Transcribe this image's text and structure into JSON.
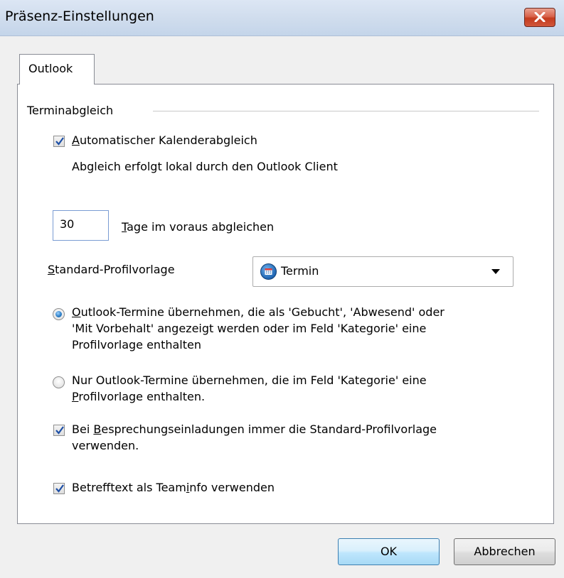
{
  "window": {
    "title": "Präsenz-Einstellungen"
  },
  "tabs": [
    {
      "label": "Outlook",
      "active": true
    }
  ],
  "group": {
    "label": "Terminabgleich"
  },
  "auto_sync": {
    "checked": true,
    "label_mnemonic": "A",
    "label_rest": "utomatischer Kalenderabgleich",
    "note": "Abgleich erfolgt lokal durch den Outlook Client"
  },
  "days_ahead": {
    "value": "30",
    "label_mnemonic": "T",
    "label_rest": "age im voraus abgleichen"
  },
  "profile_template": {
    "label_mnemonic": "S",
    "label_rest": "tandard-Profilvorlage",
    "selected": "Termin",
    "icon": "calendar-icon"
  },
  "options": {
    "radio_all": {
      "selected": true,
      "line1_mnemonic": "O",
      "line1_rest": "utlook-Termine übernehmen, die als 'Gebucht', 'Abwesend' oder",
      "line2": "'Mit Vorbehalt' angezeigt werden oder im Feld 'Kategorie' eine",
      "line3": "Profilvorlage enthalten"
    },
    "radio_category": {
      "selected": false,
      "line1": "Nur Outlook-Termine übernehmen, die im Feld 'Kategorie' eine",
      "line2_mnemonic": "P",
      "line2_rest": "rofilvorlage enthalten."
    },
    "meeting_invites": {
      "checked": true,
      "line1_pre": "Bei ",
      "line1_mnemonic": "B",
      "line1_rest": "esprechungseinladungen immer die Standard-Profilvorlage",
      "line2": "verwenden."
    },
    "subject_teaminfo": {
      "checked": true,
      "label_pre": "Betrefftext als Team",
      "label_mnemonic": "i",
      "label_rest": "nfo verwenden"
    }
  },
  "buttons": {
    "ok": "OK",
    "cancel": "Abbrechen"
  },
  "colors": {
    "titlebar": "#cfdced",
    "close_button": "#c43b1e",
    "ok_border": "#3c7fb1"
  }
}
